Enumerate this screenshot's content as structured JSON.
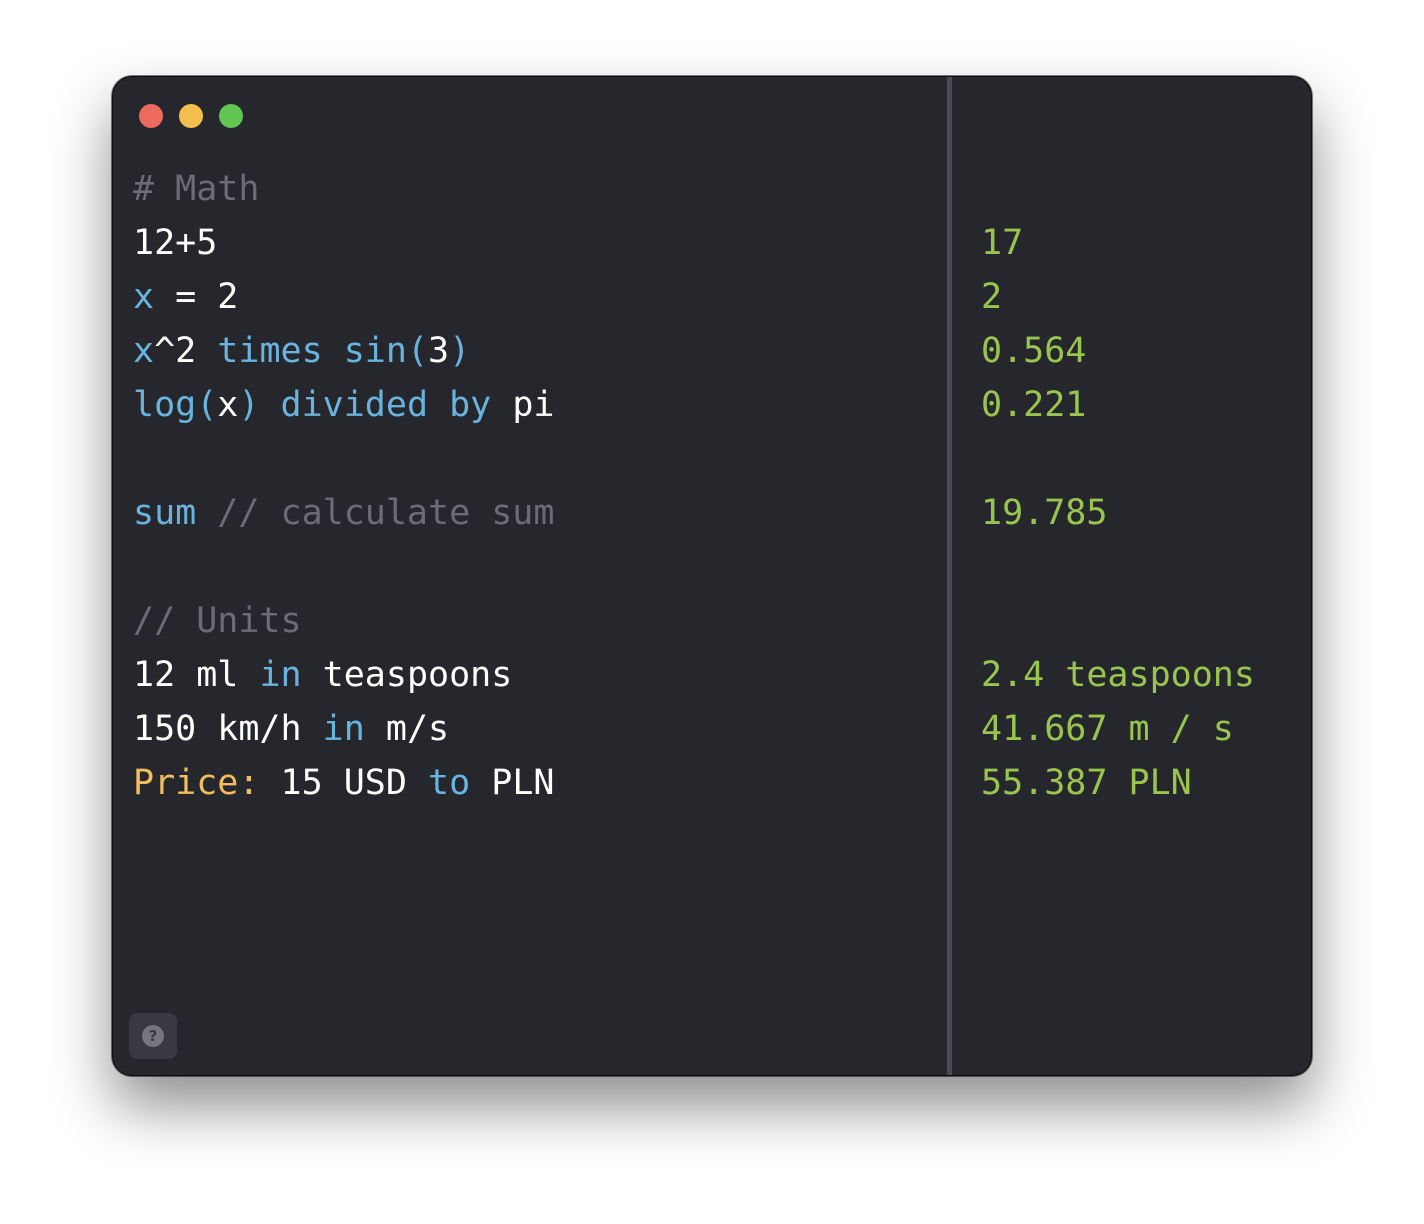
{
  "window": {
    "traffic_lights": [
      {
        "name": "close",
        "color": "#ec6a5e"
      },
      {
        "name": "minimize",
        "color": "#f4bf4f"
      },
      {
        "name": "zoom",
        "color": "#61c554"
      }
    ]
  },
  "colors": {
    "background": "#26272c",
    "default_text": "#ffffff",
    "comment": "#6b6c74",
    "keyword": "#69b4de",
    "label": "#f2bd5a",
    "result": "#99c54f"
  },
  "editor": {
    "lines": [
      {
        "tokens": [
          {
            "text": "# Math",
            "kind": "comment"
          }
        ]
      },
      {
        "tokens": [
          {
            "text": "12+5",
            "kind": "default"
          }
        ]
      },
      {
        "tokens": [
          {
            "text": "x",
            "kind": "keyword"
          },
          {
            "text": " = 2",
            "kind": "default"
          }
        ]
      },
      {
        "tokens": [
          {
            "text": "x",
            "kind": "keyword"
          },
          {
            "text": "^2 ",
            "kind": "default"
          },
          {
            "text": "times sin(",
            "kind": "keyword"
          },
          {
            "text": "3",
            "kind": "default"
          },
          {
            "text": ")",
            "kind": "keyword"
          }
        ]
      },
      {
        "tokens": [
          {
            "text": "log(",
            "kind": "keyword"
          },
          {
            "text": "x",
            "kind": "default"
          },
          {
            "text": ") divided by",
            "kind": "keyword"
          },
          {
            "text": " pi",
            "kind": "default"
          }
        ]
      },
      {
        "tokens": []
      },
      {
        "tokens": [
          {
            "text": "sum",
            "kind": "keyword"
          },
          {
            "text": " // calculate sum",
            "kind": "comment"
          }
        ]
      },
      {
        "tokens": []
      },
      {
        "tokens": [
          {
            "text": "// Units",
            "kind": "comment"
          }
        ]
      },
      {
        "tokens": [
          {
            "text": "12 ml ",
            "kind": "default"
          },
          {
            "text": "in",
            "kind": "keyword"
          },
          {
            "text": " teaspoons",
            "kind": "default"
          }
        ]
      },
      {
        "tokens": [
          {
            "text": "150 km/h ",
            "kind": "default"
          },
          {
            "text": "in",
            "kind": "keyword"
          },
          {
            "text": " m/s",
            "kind": "default"
          }
        ]
      },
      {
        "tokens": [
          {
            "text": "Price:",
            "kind": "label"
          },
          {
            "text": " 15 USD ",
            "kind": "default"
          },
          {
            "text": "to",
            "kind": "keyword"
          },
          {
            "text": " PLN",
            "kind": "default"
          }
        ]
      }
    ]
  },
  "results": {
    "lines": [
      "",
      "17",
      "2",
      "0.564",
      "0.221",
      "",
      "19.785",
      "",
      "",
      "2.4 teaspoons",
      "41.667 m / s",
      "55.387 PLN"
    ]
  },
  "help": {
    "icon": "question-mark-icon",
    "glyph": "?"
  }
}
